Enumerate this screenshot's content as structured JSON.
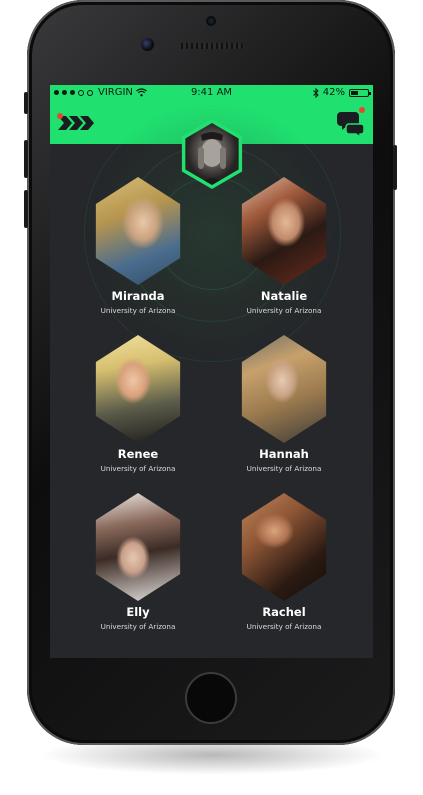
{
  "status_bar": {
    "signal_dots": [
      "full",
      "full",
      "full",
      "empty",
      "empty"
    ],
    "carrier": "VIRGIN",
    "time": "9:41 AM",
    "battery_percent": "42%",
    "battery_level": 0.42,
    "icons": [
      "wifi-icon",
      "bluetooth-icon",
      "battery-icon"
    ]
  },
  "nav": {
    "left_icon": "hex-arrows-menu-icon",
    "right_icon": "chat-bubbles-icon",
    "accent": "#20e070",
    "badge_color": "#e8452e"
  },
  "profiles": [
    {
      "name": "Miranda",
      "school": "University of Arizona"
    },
    {
      "name": "Natalie",
      "school": "University of Arizona"
    },
    {
      "name": "Renee",
      "school": "University of Arizona"
    },
    {
      "name": "Hannah",
      "school": "University of Arizona"
    },
    {
      "name": "Elly",
      "school": "University of Arizona"
    },
    {
      "name": "Rachel",
      "school": "University of Arizona"
    }
  ],
  "colors": {
    "screen_bg": "#25272a",
    "accent_green": "#20e070",
    "text": "#ffffff"
  }
}
